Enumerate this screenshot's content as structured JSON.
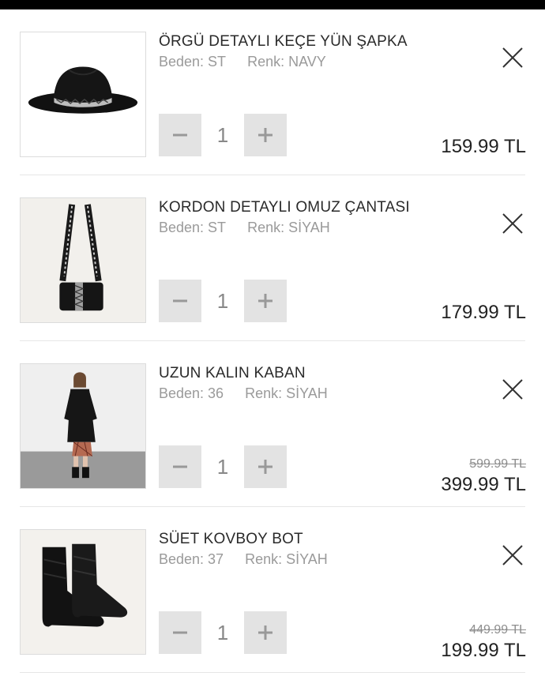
{
  "items": [
    {
      "name": "ÖRGÜ DETAYLI KEÇE YÜN ŞAPKA",
      "size_label": "Beden: ST",
      "color_label": "Renk: NAVY",
      "quantity": "1",
      "old_price": "",
      "price": "159.99 TL",
      "image_icon": "hat-image"
    },
    {
      "name": "KORDON DETAYLI OMUZ ÇANTASI",
      "size_label": "Beden: ST",
      "color_label": "Renk: SİYAH",
      "quantity": "1",
      "old_price": "",
      "price": "179.99 TL",
      "image_icon": "bag-image"
    },
    {
      "name": "UZUN KALIN KABAN",
      "size_label": "Beden: 36",
      "color_label": "Renk: SİYAH",
      "quantity": "1",
      "old_price": "599.99 TL",
      "price": "399.99 TL",
      "image_icon": "coat-model-image"
    },
    {
      "name": "SÜET KOVBOY BOT",
      "size_label": "Beden: 37",
      "color_label": "Renk: SİYAH",
      "quantity": "1",
      "old_price": "449.99 TL",
      "price": "199.99 TL",
      "image_icon": "boots-image"
    }
  ],
  "colors": {
    "accent_text": "#222222",
    "muted_text": "#9a9a9a",
    "stepper_bg": "#e3e3e3"
  }
}
